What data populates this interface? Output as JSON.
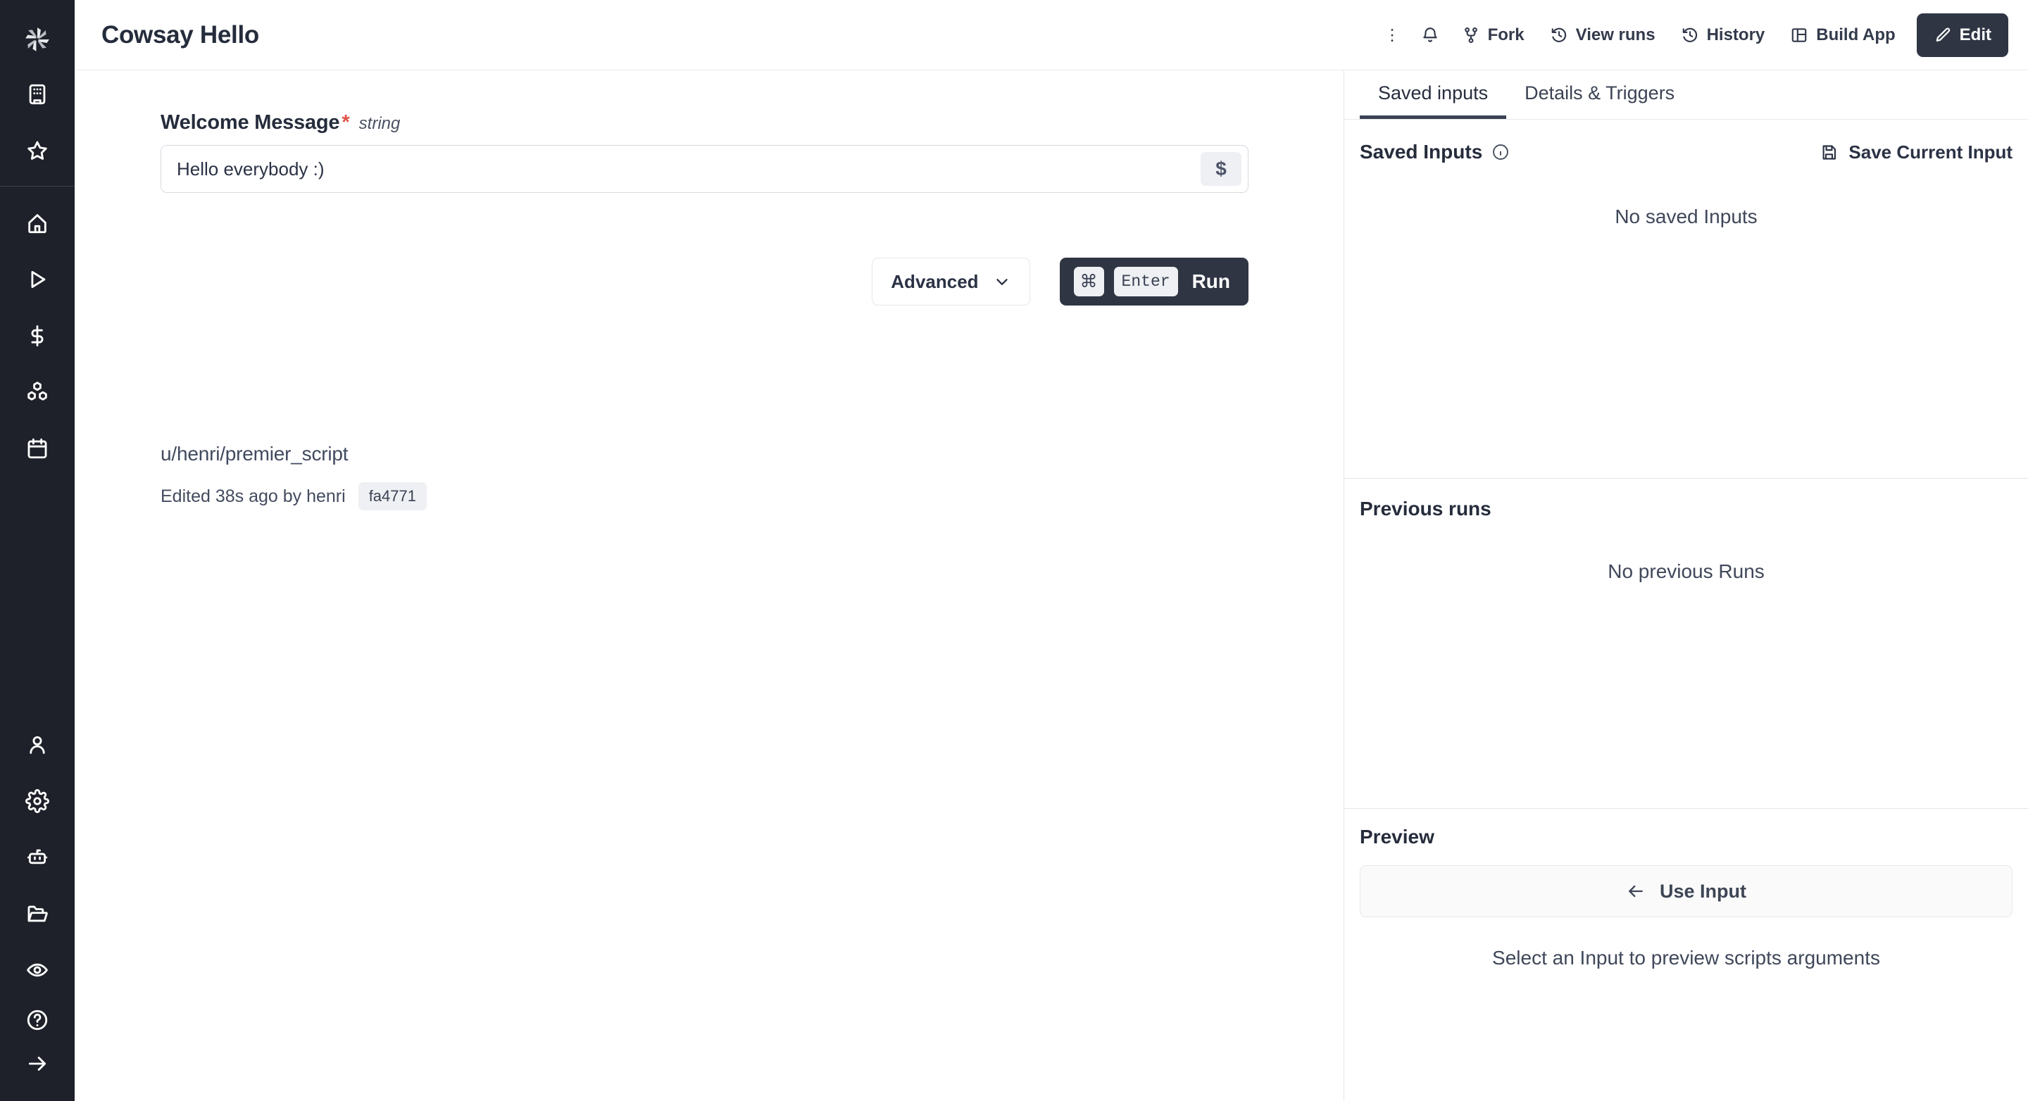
{
  "app": {
    "logo_icon": "windmill-logo-icon"
  },
  "sidebar": {
    "top_items": [
      {
        "icon": "building-icon",
        "name": "workspace"
      },
      {
        "icon": "star-icon",
        "name": "favorites"
      }
    ],
    "nav_items": [
      {
        "icon": "home-icon",
        "name": "home"
      },
      {
        "icon": "play-icon",
        "name": "runs"
      },
      {
        "icon": "dollar-icon",
        "name": "variables"
      },
      {
        "icon": "boxes-icon",
        "name": "resources"
      },
      {
        "icon": "calendar-icon",
        "name": "schedules"
      }
    ],
    "admin_items": [
      {
        "icon": "user-icon",
        "name": "users"
      },
      {
        "icon": "gear-icon",
        "name": "settings"
      },
      {
        "icon": "robot-icon",
        "name": "workers"
      },
      {
        "icon": "folder-icon",
        "name": "folders"
      },
      {
        "icon": "eye-icon",
        "name": "audit-logs"
      }
    ],
    "bottom_items": [
      {
        "icon": "help-circle-icon",
        "name": "help"
      },
      {
        "icon": "arrow-right-icon",
        "name": "expand-sidebar"
      }
    ]
  },
  "header": {
    "title": "Cowsay Hello",
    "more_icon": "more-vertical-icon",
    "notifications_icon": "bell-icon",
    "fork": {
      "label": "Fork",
      "icon": "fork-icon"
    },
    "view_runs": {
      "label": "View runs",
      "icon": "history-clock-icon"
    },
    "history": {
      "label": "History",
      "icon": "history-clock-icon"
    },
    "build_app": {
      "label": "Build App",
      "icon": "layout-panel-icon"
    },
    "edit": {
      "label": "Edit",
      "icon": "pencil-icon"
    }
  },
  "form": {
    "field_label": "Welcome Message",
    "required_marker": "*",
    "type_hint": "string",
    "input_value": "Hello everybody :)",
    "input_placeholder": "",
    "variable_button_label": "$",
    "advanced_label": "Advanced",
    "advanced_icon": "chevron-down-icon",
    "run": {
      "key_cmd": "⌘",
      "key_enter": "Enter",
      "label": "Run"
    }
  },
  "script_meta": {
    "path": "u/henri/premier_script",
    "edited_text": "Edited 38s ago by henri",
    "hash": "fa4771"
  },
  "panel": {
    "tabs": [
      {
        "label": "Saved inputs",
        "active": true
      },
      {
        "label": "Details & Triggers",
        "active": false
      }
    ],
    "saved_inputs": {
      "title": "Saved Inputs",
      "info_icon": "info-circle-icon",
      "save_button_label": "Save Current Input",
      "save_button_icon": "save-icon",
      "empty_text": "No saved Inputs"
    },
    "previous_runs": {
      "title": "Previous runs",
      "empty_text": "No previous Runs"
    },
    "preview": {
      "title": "Preview",
      "use_input_label": "Use Input",
      "use_input_icon": "arrow-left-icon",
      "hint": "Select an Input to preview scripts arguments"
    }
  },
  "colors": {
    "sidebar_bg": "#1e2129",
    "accent_dark": "#2f3543",
    "required_star": "#e1534a",
    "border": "#e3e6ea"
  }
}
